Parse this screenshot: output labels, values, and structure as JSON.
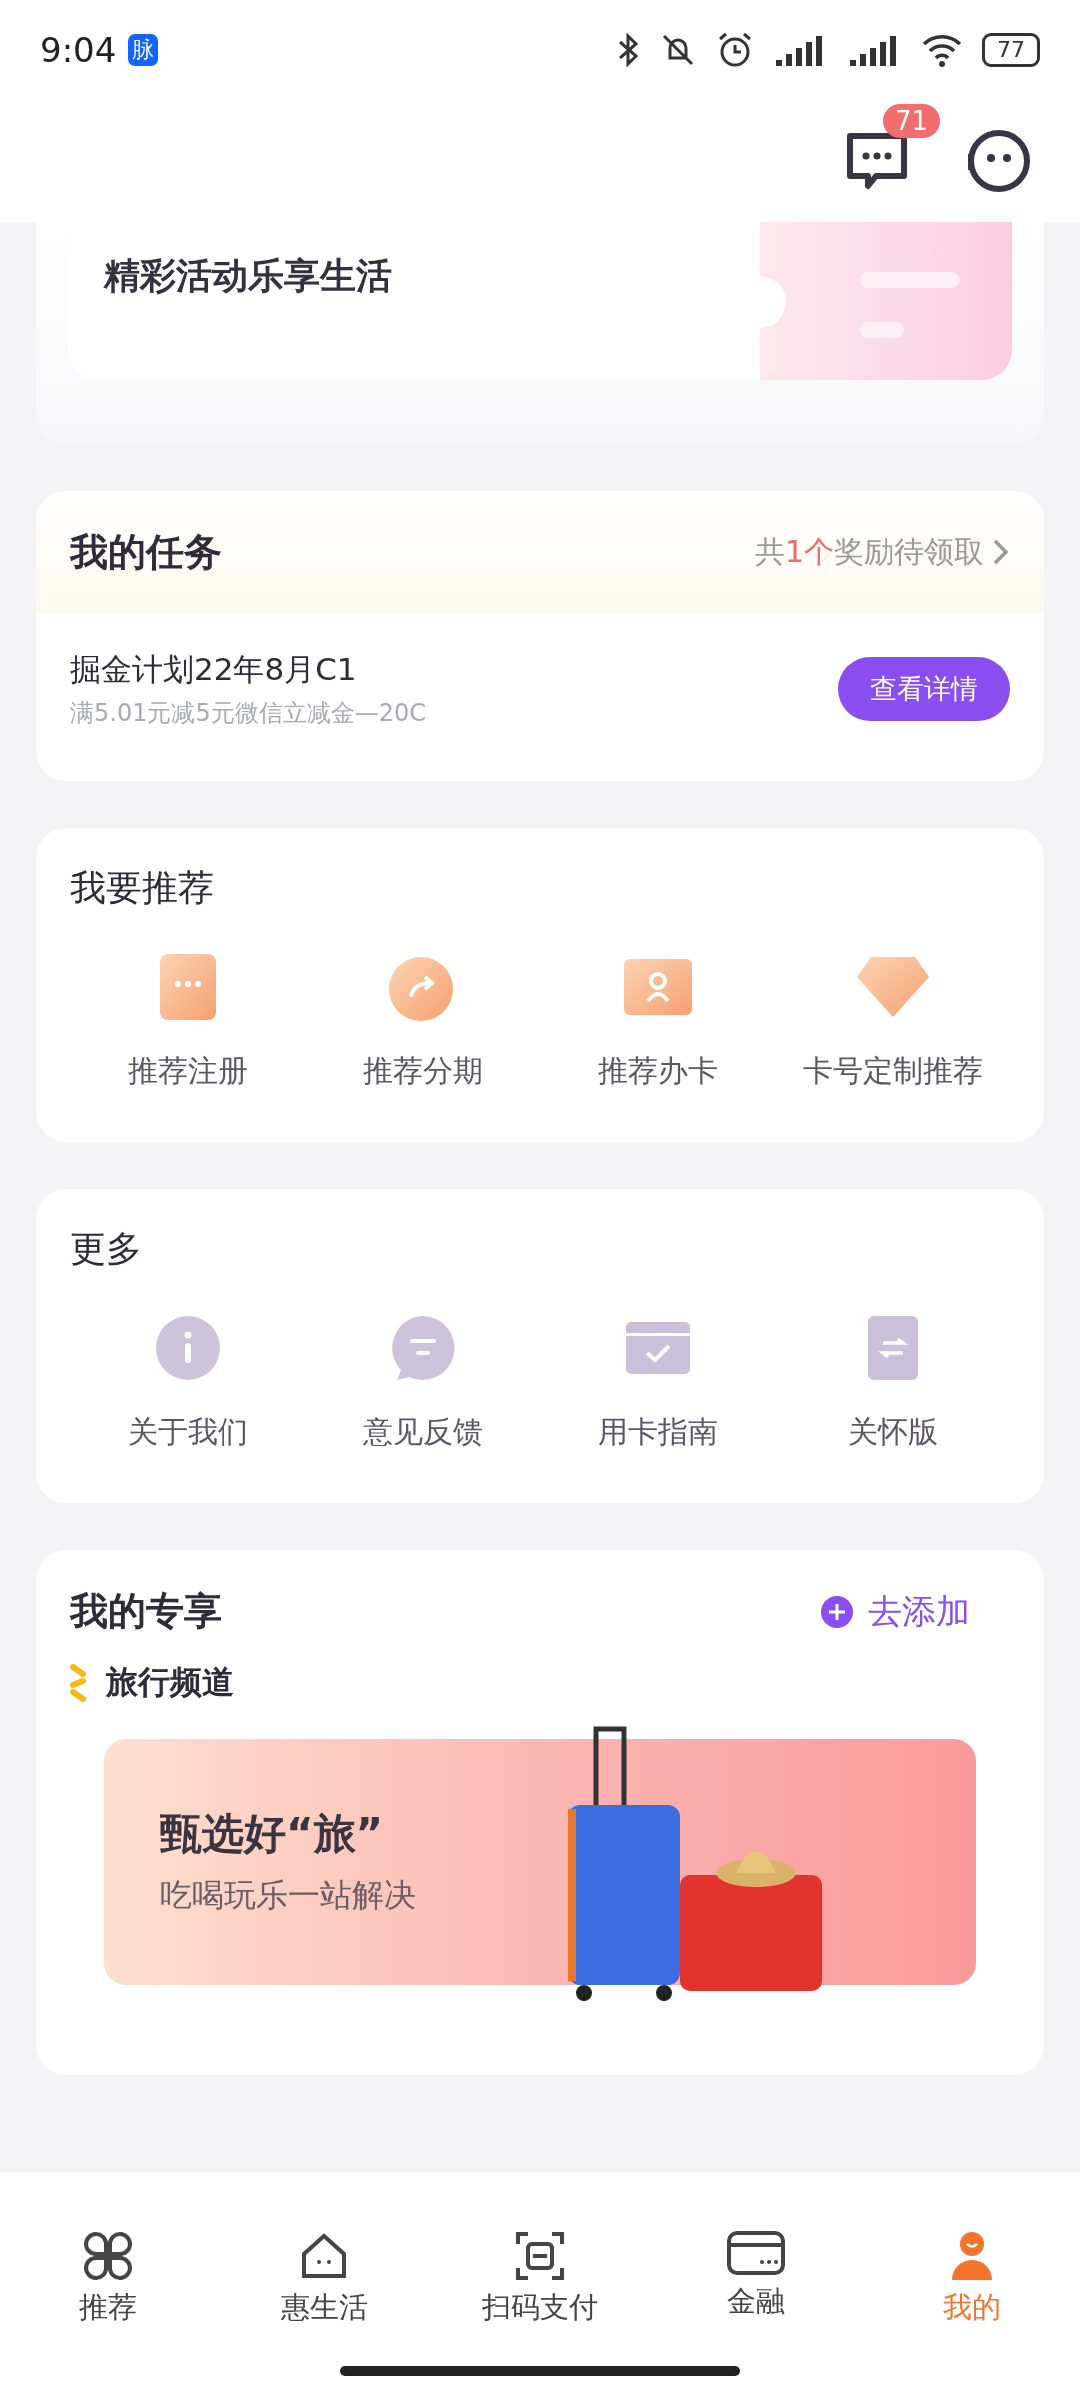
{
  "status_bar": {
    "time": "9:04",
    "app_badge": "脉",
    "battery": "77"
  },
  "header": {
    "messages_badge": "71"
  },
  "promo_card": {
    "title": "精彩活动乐享生活"
  },
  "tasks": {
    "title": "我的任务",
    "summary_prefix": "共",
    "summary_count": "1个",
    "summary_suffix": "奖励待领取",
    "items": [
      {
        "title": "掘金计划22年8月C1",
        "subtitle": "满5.01元减5元微信立减金—20C",
        "action": "查看详情"
      }
    ]
  },
  "recommend": {
    "title": "我要推荐",
    "items": [
      {
        "label": "推荐注册",
        "kind": "register"
      },
      {
        "label": "推荐分期",
        "kind": "share"
      },
      {
        "label": "推荐办卡",
        "kind": "card"
      },
      {
        "label": "卡号定制推荐",
        "kind": "number"
      }
    ]
  },
  "more": {
    "title": "更多",
    "items": [
      {
        "label": "关于我们",
        "kind": "info"
      },
      {
        "label": "意见反馈",
        "kind": "feedback"
      },
      {
        "label": "用卡指南",
        "kind": "guide"
      },
      {
        "label": "关怀版",
        "kind": "care"
      }
    ]
  },
  "exclusive": {
    "title": "我的专享",
    "add": "去添加",
    "channel": "旅行频道",
    "banner": {
      "title": "甄选好“旅”",
      "subtitle": "吃喝玩乐一站解决"
    }
  },
  "tabs": [
    {
      "label": "推荐",
      "kind": "clover",
      "selected": false
    },
    {
      "label": "惠生活",
      "kind": "house",
      "selected": false
    },
    {
      "label": "扫码支付",
      "kind": "scan",
      "selected": false
    },
    {
      "label": "金融",
      "kind": "wallet",
      "selected": false
    },
    {
      "label": "我的",
      "kind": "person",
      "selected": true
    }
  ]
}
